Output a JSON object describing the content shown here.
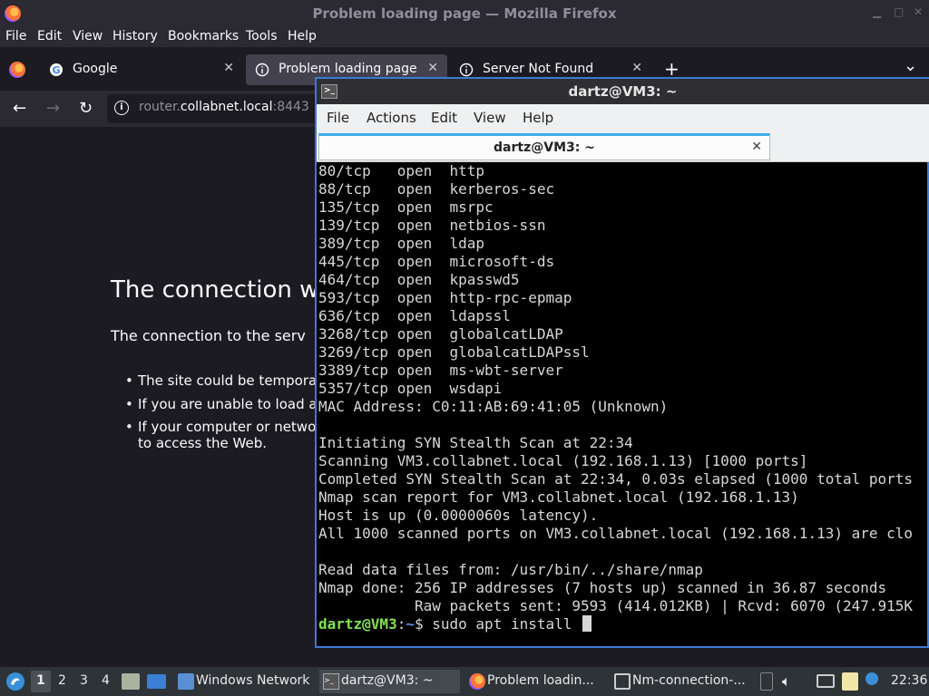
{
  "firefox": {
    "window_title": "Problem loading page — Mozilla Firefox",
    "menu": [
      "File",
      "Edit",
      "View",
      "History",
      "Bookmarks",
      "Tools",
      "Help"
    ],
    "tabs": [
      {
        "label": "Google",
        "close": "✕"
      },
      {
        "label": "Problem loading page",
        "close": "✕"
      },
      {
        "label": "Server Not Found",
        "close": "✕"
      }
    ],
    "new_tab": "+",
    "list_tabs": "⌄",
    "nav": {
      "back": "←",
      "forward": "→",
      "reload": "↻"
    },
    "url": {
      "prefix": "router.",
      "host": "collabnet.local",
      "port": ":8443"
    },
    "error": {
      "title": "The connection w",
      "description": "The connection to the serv",
      "bullets": [
        "The site could be tempora",
        "If you are unable to load a",
        "If your computer or netwo",
        "to access the Web."
      ]
    }
  },
  "terminal": {
    "window_title": "dartz@VM3: ~",
    "menu": [
      "File",
      "Actions",
      "Edit",
      "View",
      "Help"
    ],
    "tab_label": "dartz@VM3: ~",
    "tab_close": "✕",
    "lines": [
      "80/tcp   open  http",
      "88/tcp   open  kerberos-sec",
      "135/tcp  open  msrpc",
      "139/tcp  open  netbios-ssn",
      "389/tcp  open  ldap",
      "445/tcp  open  microsoft-ds",
      "464/tcp  open  kpasswd5",
      "593/tcp  open  http-rpc-epmap",
      "636/tcp  open  ldapssl",
      "3268/tcp open  globalcatLDAP",
      "3269/tcp open  globalcatLDAPssl",
      "3389/tcp open  ms-wbt-server",
      "5357/tcp open  wsdapi",
      "MAC Address: C0:11:AB:69:41:05 (Unknown)",
      "",
      "Initiating SYN Stealth Scan at 22:34",
      "Scanning VM3.collabnet.local (192.168.1.13) [1000 ports]",
      "Completed SYN Stealth Scan at 22:34, 0.03s elapsed (1000 total ports",
      "Nmap scan report for VM3.collabnet.local (192.168.1.13)",
      "Host is up (0.0000060s latency).",
      "All 1000 scanned ports on VM3.collabnet.local (192.168.1.13) are clo",
      "",
      "Read data files from: /usr/bin/../share/nmap",
      "Nmap done: 256 IP addresses (7 hosts up) scanned in 36.87 seconds",
      "           Raw packets sent: 9593 (414.012KB) | Rcvd: 6070 (247.915K"
    ],
    "prompt": {
      "user": "dartz@VM3",
      "sep": ":",
      "path": "~",
      "symbol": "$",
      "command": " sudo apt install "
    }
  },
  "taskbar": {
    "workspaces": [
      "1",
      "2",
      "3",
      "4"
    ],
    "windows": [
      {
        "label": "Windows Network"
      },
      {
        "label": "dartz@VM3: ~"
      },
      {
        "label": "Problem loadin..."
      },
      {
        "label": "Nm-connection-..."
      }
    ],
    "clock": "22:36"
  }
}
